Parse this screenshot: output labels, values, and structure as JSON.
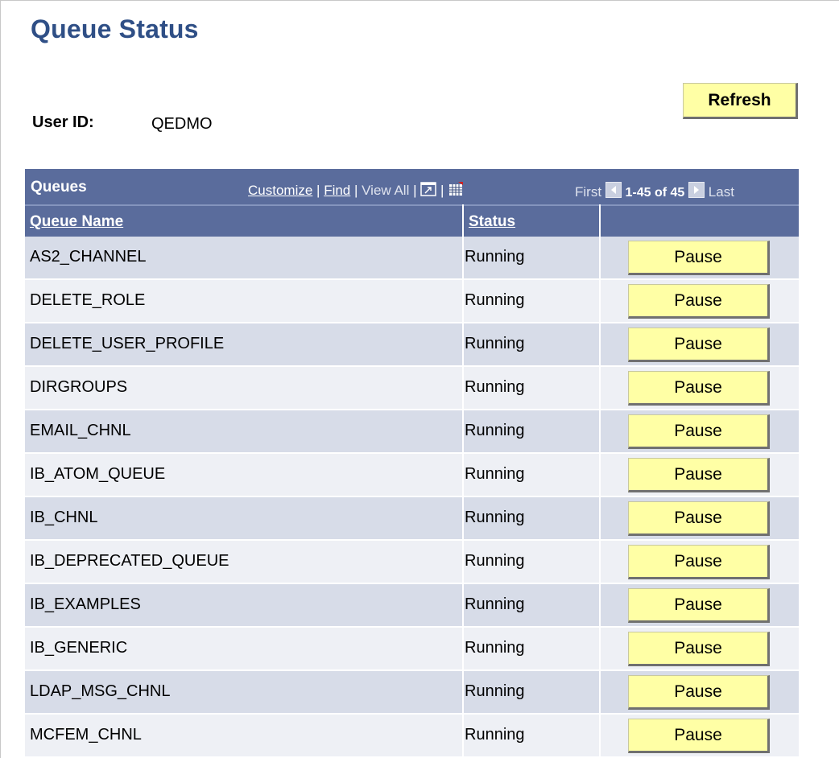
{
  "page": {
    "title": "Queue Status",
    "user_id_label": "User ID:",
    "user_id_value": "QEDMO",
    "refresh_label": "Refresh"
  },
  "grid": {
    "title": "Queues",
    "customize_label": "Customize",
    "find_label": "Find",
    "view_all_label": "View All",
    "first_label": "First",
    "range_label": "1-45 of 45",
    "last_label": "Last",
    "col_queue_name": "Queue Name",
    "col_status": "Status",
    "pause_label": "Pause",
    "rows": [
      {
        "name": "AS2_CHANNEL",
        "status": "Running"
      },
      {
        "name": "DELETE_ROLE",
        "status": "Running"
      },
      {
        "name": "DELETE_USER_PROFILE",
        "status": "Running"
      },
      {
        "name": "DIRGROUPS",
        "status": "Running"
      },
      {
        "name": "EMAIL_CHNL",
        "status": "Running"
      },
      {
        "name": "IB_ATOM_QUEUE",
        "status": "Running"
      },
      {
        "name": "IB_CHNL",
        "status": "Running"
      },
      {
        "name": "IB_DEPRECATED_QUEUE",
        "status": "Running"
      },
      {
        "name": "IB_EXAMPLES",
        "status": "Running"
      },
      {
        "name": "IB_GENERIC",
        "status": "Running"
      },
      {
        "name": "LDAP_MSG_CHNL",
        "status": "Running"
      },
      {
        "name": "MCFEM_CHNL",
        "status": "Running"
      }
    ]
  },
  "colors": {
    "header_bg": "#5a6c9c",
    "title_color": "#2f4f86",
    "button_bg": "#ffffa5",
    "row_odd": "#d7dce8",
    "row_even": "#eef0f5"
  }
}
